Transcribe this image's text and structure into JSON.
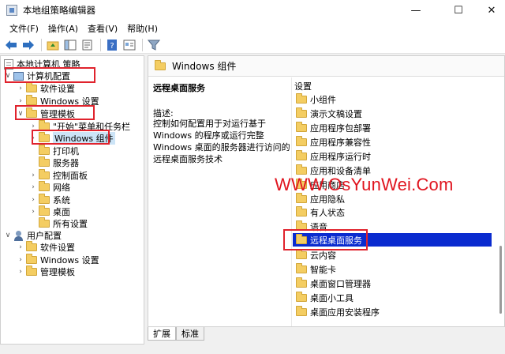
{
  "window": {
    "title": "本地组策略编辑器",
    "minimize": "—",
    "maximize": "☐",
    "close": "✕"
  },
  "menu": [
    "文件(F)",
    "操作(A)",
    "查看(V)",
    "帮助(H)"
  ],
  "toolbar": {
    "icons": [
      "back-icon",
      "forward-icon",
      "up-folder-icon",
      "show-hide-tree-icon",
      "export-list-icon",
      "help-icon",
      "properties-icon",
      "filter-icon"
    ]
  },
  "tree": {
    "root": "本地计算机 策略",
    "computer_config": "计算机配置",
    "software_settings": "软件设置",
    "windows_settings": "Windows 设置",
    "admin_templates": "管理模板",
    "start_menu": "\"开始\"菜单和任务栏",
    "windows_components": "Windows 组件",
    "printers": "打印机",
    "server": "服务器",
    "control_panel": "控制面板",
    "network": "网络",
    "system": "系统",
    "desktop": "桌面",
    "all_settings": "所有设置",
    "user_config": "用户配置",
    "user_software_settings": "软件设置",
    "user_windows_settings": "Windows 设置",
    "user_admin_templates": "管理模板"
  },
  "right": {
    "header": "Windows 组件",
    "desc_title": "远程桌面服务",
    "desc_label": "描述:",
    "desc_text": "控制如何配置用于对运行基于 Windows 的程序或运行完整 Windows 桌面的服务器进行访问的远程桌面服务技术",
    "column_header": "设置",
    "items": [
      "小组件",
      "演示文稿设置",
      "应用程序包部署",
      "应用程序兼容性",
      "应用程序运行时",
      "应用和设备清单",
      "应用商店",
      "应用隐私",
      "有人状态",
      "语音",
      "远程桌面服务",
      "云内容",
      "智能卡",
      "桌面窗口管理器",
      "桌面小工具",
      "桌面应用安装程序"
    ],
    "selected_index": 10
  },
  "tabs": [
    "扩展",
    "标准"
  ],
  "watermark": "WWW.OsYunWei.Com",
  "colors": {
    "highlight_box": "#e0232d",
    "selection": "#0a2bcf",
    "folder": "#f4cd62"
  }
}
